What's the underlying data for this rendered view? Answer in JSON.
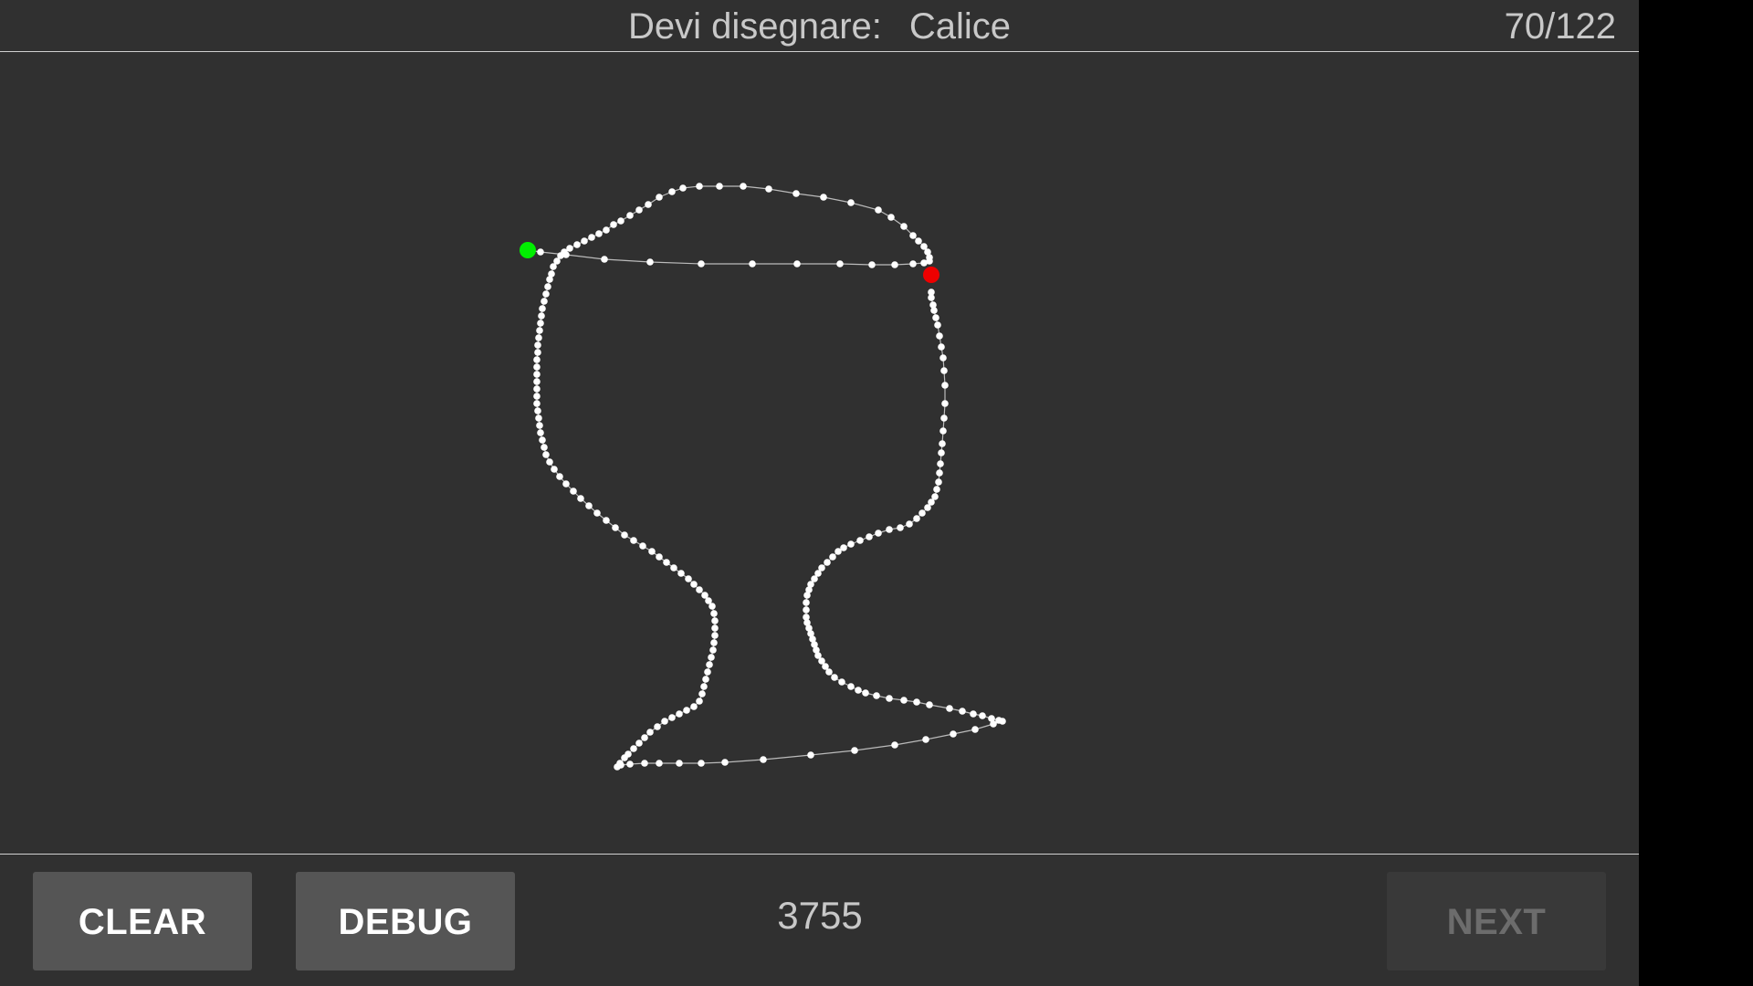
{
  "header": {
    "prompt_label": "Devi disegnare:",
    "prompt_word": "Calice",
    "progress": "70/122"
  },
  "drawing": {
    "stroke_color": "#ffffff",
    "start_marker_color": "#00ee00",
    "end_marker_color": "#ee0000",
    "point_count_shown": "3755"
  },
  "footer": {
    "clear_label": "CLEAR",
    "debug_label": "DEBUG",
    "score": "3755",
    "next_label": "NEXT",
    "next_enabled": false
  },
  "colors": {
    "background": "#303030",
    "button": "#555555",
    "button_disabled": "#393939",
    "text": "#c8c8c8"
  }
}
